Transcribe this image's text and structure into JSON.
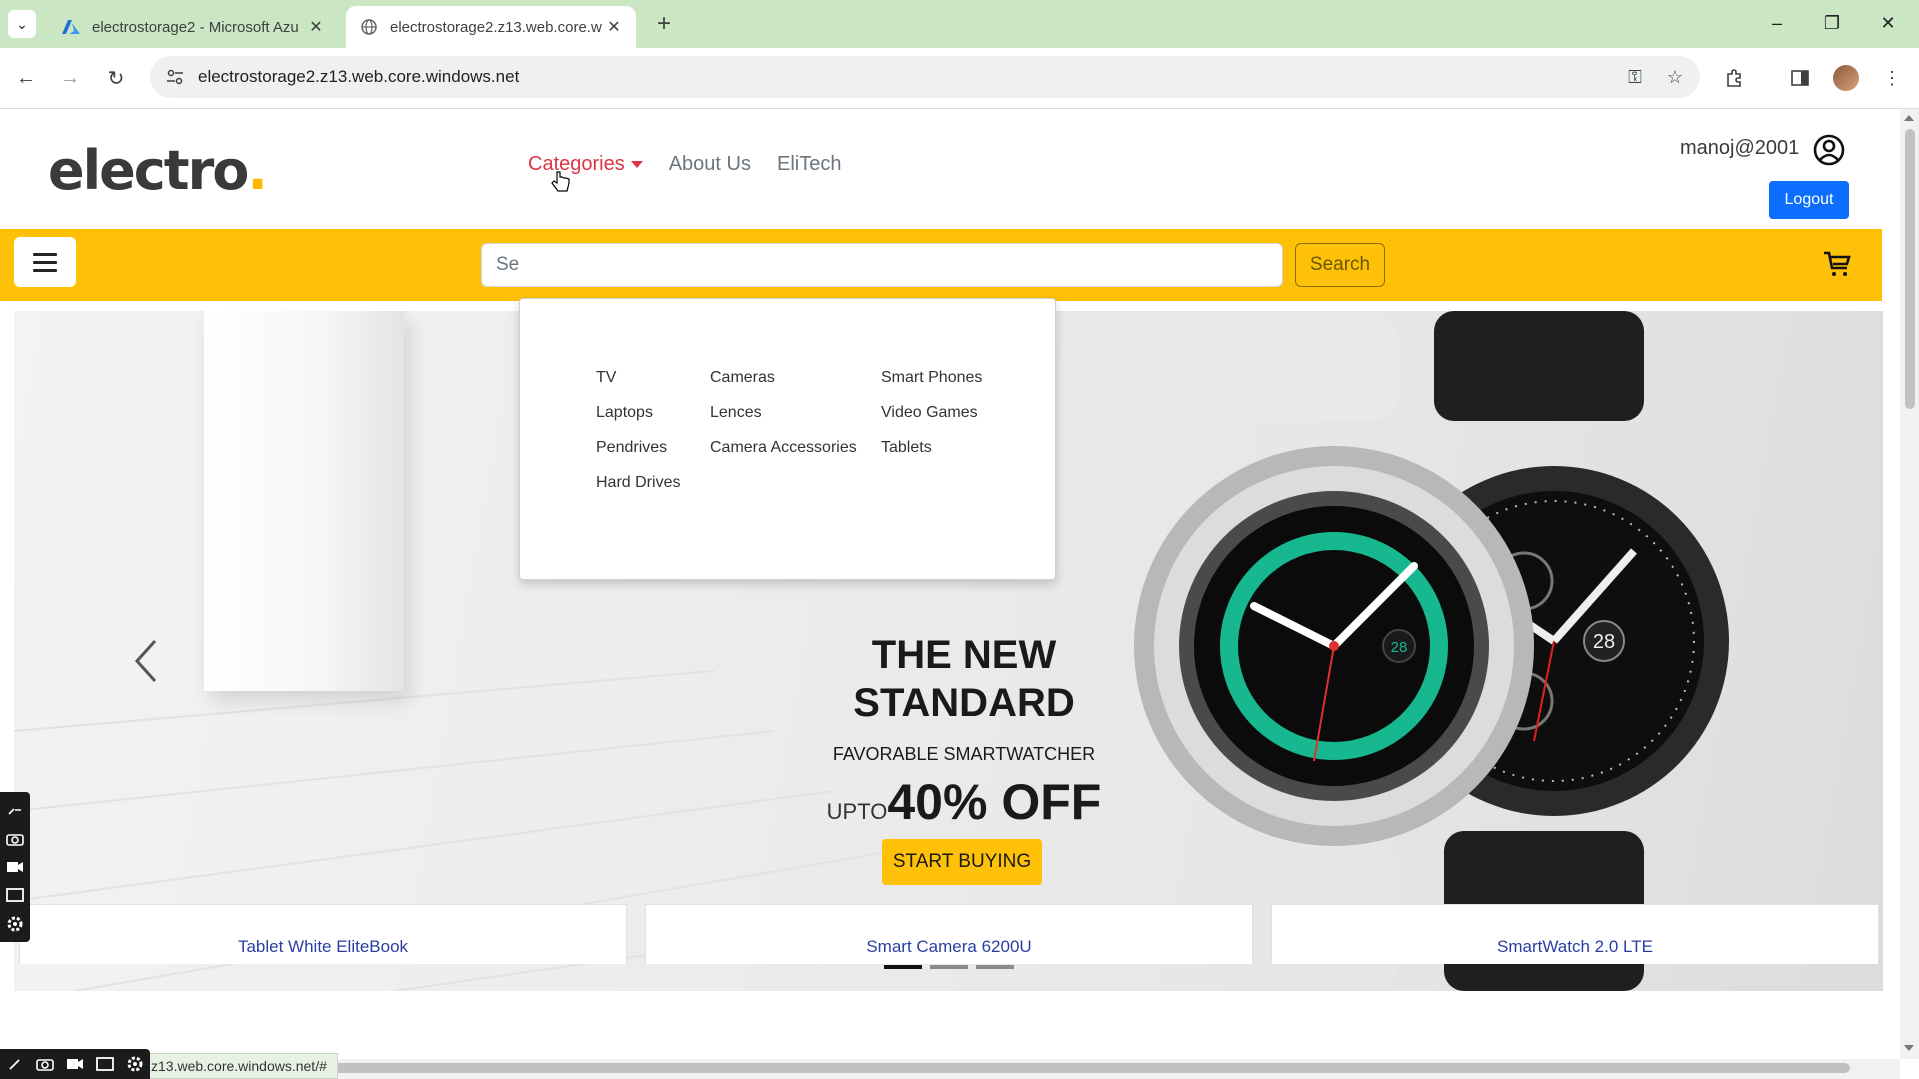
{
  "browser": {
    "tabs": [
      {
        "title": "electrostorage2 - Microsoft Azu",
        "active": false,
        "favicon": "azure-icon"
      },
      {
        "title": "electrostorage2.z13.web.core.w",
        "active": true,
        "favicon": "globe-icon"
      }
    ],
    "url": "electrostorage2.z13.web.core.windows.net",
    "status_url": "z13.web.core.windows.net/#"
  },
  "site": {
    "logo_text": "electro",
    "logo_dot": ".",
    "nav": {
      "categories": "Categories",
      "about": "About Us",
      "elitech": "EliTech"
    },
    "user": {
      "name": "manoj@2001",
      "logout": "Logout"
    },
    "search": {
      "placeholder": "Se",
      "button": "Search"
    },
    "categories_menu": {
      "col1": [
        "TV",
        "Laptops",
        "Pendrives",
        "Hard Drives"
      ],
      "col2": [
        "Cameras",
        "Lences",
        "Camera Accessories"
      ],
      "col3": [
        "Smart Phones",
        "Video Games",
        "Tablets"
      ]
    },
    "hero": {
      "title_line1": "THE NEW",
      "title_line2": "STANDARD",
      "subtitle": "FAVORABLE SMARTWATCHER",
      "offer_prefix": "UPTO",
      "offer": "40% OFF",
      "cta": "START BUYING",
      "slides": 3,
      "active_slide": 1
    },
    "products": [
      {
        "title": "Tablet White EliteBook"
      },
      {
        "title": "Smart Camera 6200U"
      },
      {
        "title": "SmartWatch 2.0 LTE"
      }
    ]
  },
  "colors": {
    "accent_yellow": "#ffc107",
    "nav_active": "#dc3545",
    "logout_blue": "#0d6efd",
    "chrome_green": "#cbe6c3"
  }
}
